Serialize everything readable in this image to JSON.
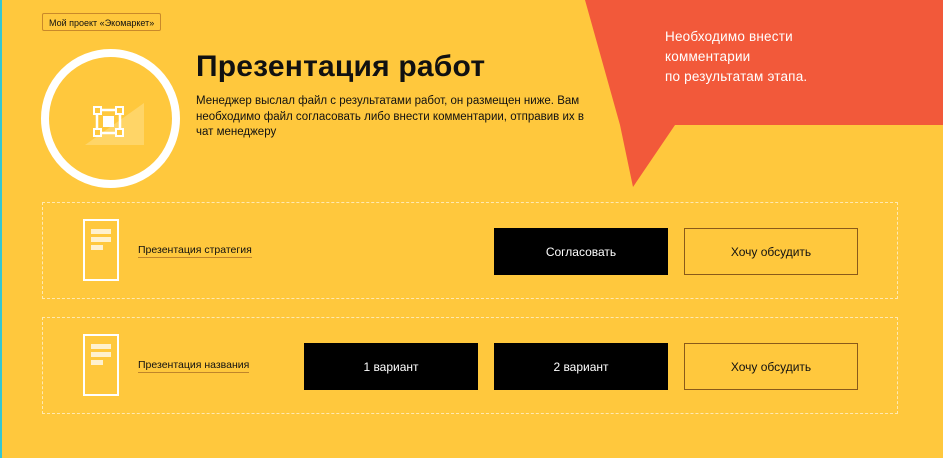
{
  "project_badge": "Мой проект «Экомаркет»",
  "page": {
    "title": "Презентация работ",
    "description": "Менеджер выслал файл с результатами работ, он размещен ниже. Вам необходимо файл согласовать либо внести комментарии, отправив их в чат менеджеру"
  },
  "callout": {
    "line1": "Необходимо внести",
    "line2": "комментарии",
    "line3": "по результатам этапа."
  },
  "items": [
    {
      "file_label": "Презентация стратегия",
      "approve_label": "Согласовать",
      "discuss_label": "Хочу обсудить"
    },
    {
      "file_label": "Презентация названия",
      "variant1_label": "1 вариант",
      "variant2_label": "2 вариант",
      "discuss_label": "Хочу обсудить"
    }
  ],
  "colors": {
    "background": "#FFC83D",
    "callout": "#F2593A",
    "button_dark": "#000000",
    "text_light": "#FFFFFF"
  },
  "icons": {
    "hero": "frame-transform-icon",
    "file": "document-icon"
  }
}
